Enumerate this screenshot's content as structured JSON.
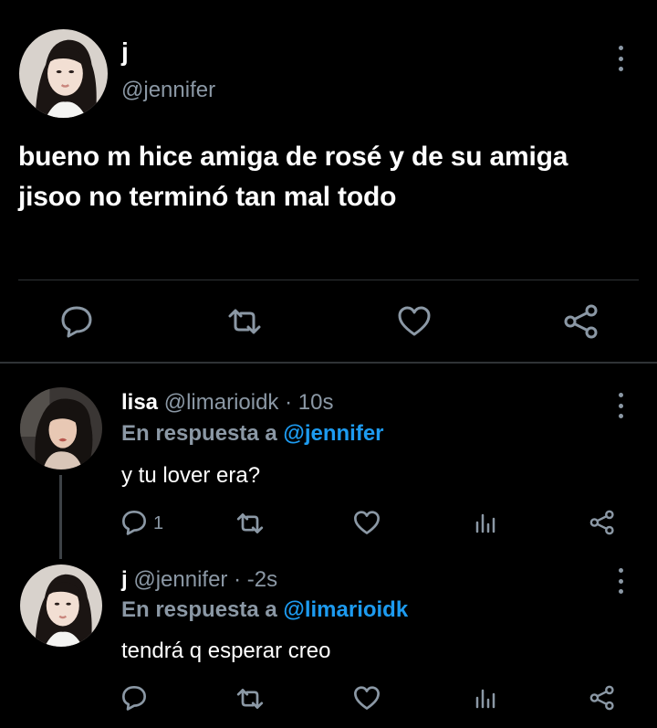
{
  "main_tweet": {
    "name": "j",
    "handle": "@jennifer",
    "text_line1": "bueno m hice amiga de rosé y de su amiga",
    "text_line2": "jisoo no terminó tan mal todo"
  },
  "reply1": {
    "name": "lisa",
    "handle_time": "@limarioidk · 10s",
    "in_reply_prefix": "En respuesta a",
    "in_reply_handle": "@jennifer",
    "text": "y tu lover era?",
    "reply_count": "1"
  },
  "reply2": {
    "name": "j",
    "handle_time": "@jennifer · -2s",
    "in_reply_prefix": "En respuesta a",
    "in_reply_handle": "@limarioidk",
    "text": "tendrá q esperar creo"
  },
  "icons": [
    "reply-icon",
    "retweet-icon",
    "like-icon",
    "share-icon",
    "more-icon",
    "analytics-icon"
  ],
  "colors": {
    "background": "#000000",
    "text": "#ffffff",
    "muted": "#8b98a5",
    "accent": "#1d9bf0",
    "divider": "#2f3336"
  }
}
